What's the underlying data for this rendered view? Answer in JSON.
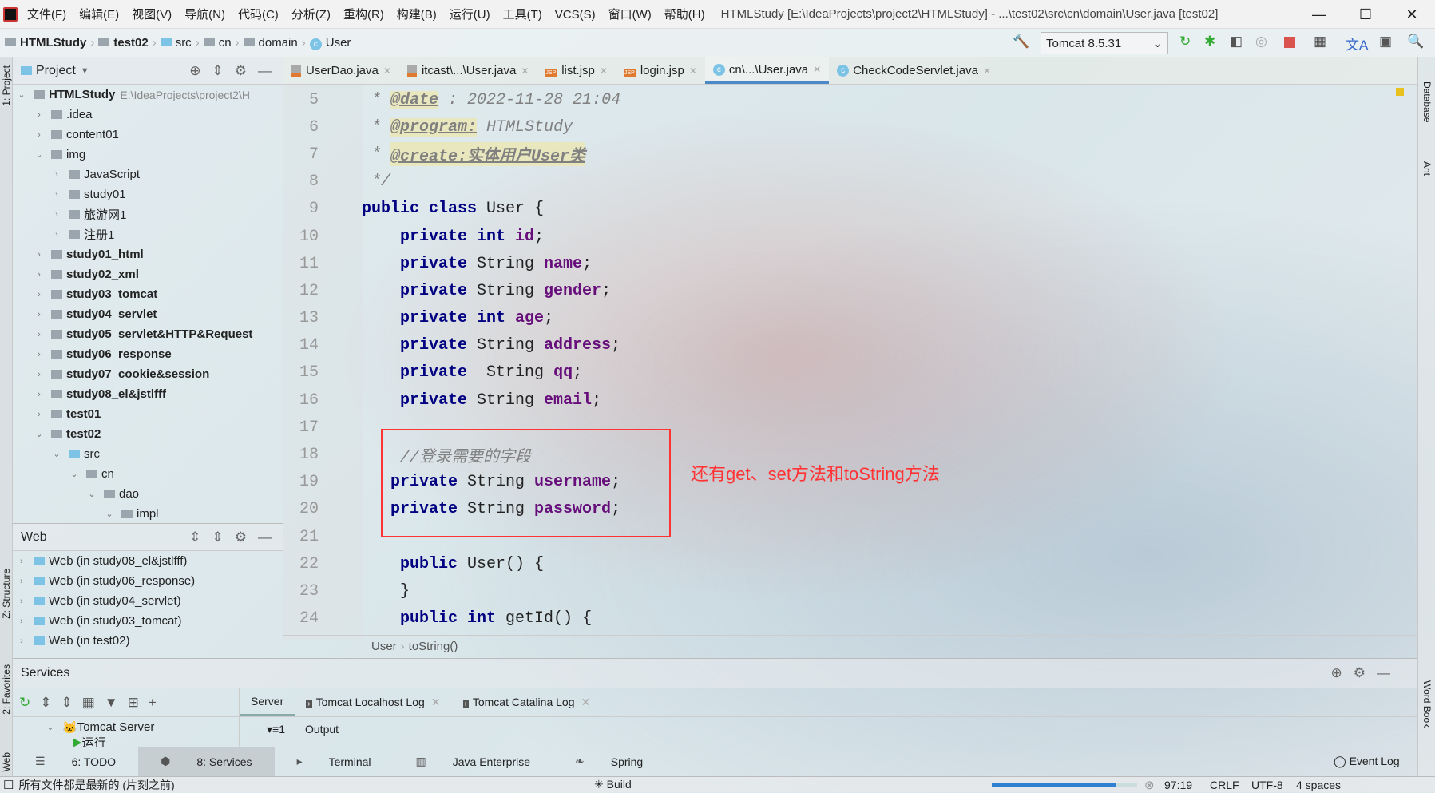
{
  "titlebar": {
    "menu": [
      "文件(F)",
      "编辑(E)",
      "视图(V)",
      "导航(N)",
      "代码(C)",
      "分析(Z)",
      "重构(R)",
      "构建(B)",
      "运行(U)",
      "工具(T)",
      "VCS(S)",
      "窗口(W)",
      "帮助(H)"
    ],
    "title": "HTMLStudy [E:\\IdeaProjects\\project2\\HTMLStudy] - ...\\test02\\src\\cn\\domain\\User.java [test02]"
  },
  "breadcrumb": [
    "HTMLStudy",
    "test02",
    "src",
    "cn",
    "domain",
    "User"
  ],
  "run_config": "Tomcat 8.5.31",
  "project_panel": {
    "title": "Project",
    "root": "HTMLStudy",
    "root_path": "E:\\IdeaProjects\\project2\\H",
    "items": [
      {
        "label": ".idea",
        "depth": 1,
        "state": "closed",
        "bold": false
      },
      {
        "label": "content01",
        "depth": 1,
        "state": "closed",
        "bold": false
      },
      {
        "label": "img",
        "depth": 1,
        "state": "open",
        "bold": false
      },
      {
        "label": "JavaScript",
        "depth": 2,
        "state": "closed",
        "bold": false
      },
      {
        "label": "study01",
        "depth": 2,
        "state": "closed",
        "bold": false
      },
      {
        "label": "旅游网1",
        "depth": 2,
        "state": "closed",
        "bold": false
      },
      {
        "label": "注册1",
        "depth": 2,
        "state": "closed",
        "bold": false
      },
      {
        "label": "study01_html",
        "depth": 1,
        "state": "closed",
        "bold": true
      },
      {
        "label": "study02_xml",
        "depth": 1,
        "state": "closed",
        "bold": true
      },
      {
        "label": "study03_tomcat",
        "depth": 1,
        "state": "closed",
        "bold": true
      },
      {
        "label": "study04_servlet",
        "depth": 1,
        "state": "closed",
        "bold": true
      },
      {
        "label": "study05_servlet&HTTP&Request",
        "depth": 1,
        "state": "closed",
        "bold": true
      },
      {
        "label": "study06_response",
        "depth": 1,
        "state": "closed",
        "bold": true
      },
      {
        "label": "study07_cookie&session",
        "depth": 1,
        "state": "closed",
        "bold": true
      },
      {
        "label": "study08_el&jstlfff",
        "depth": 1,
        "state": "closed",
        "bold": true
      },
      {
        "label": "test01",
        "depth": 1,
        "state": "closed",
        "bold": true
      },
      {
        "label": "test02",
        "depth": 1,
        "state": "open",
        "bold": true
      },
      {
        "label": "src",
        "depth": 2,
        "state": "open",
        "bold": false
      },
      {
        "label": "cn",
        "depth": 3,
        "state": "open",
        "bold": false
      },
      {
        "label": "dao",
        "depth": 4,
        "state": "open",
        "bold": false
      },
      {
        "label": "impl",
        "depth": 5,
        "state": "open",
        "bold": false
      }
    ]
  },
  "web_panel": {
    "title": "Web",
    "items": [
      "Web (in study08_el&jstlfff)",
      "Web (in study06_response)",
      "Web (in study04_servlet)",
      "Web (in study03_tomcat)",
      "Web (in test02)"
    ]
  },
  "tabs": [
    {
      "label": "UserDao.java",
      "type": "java"
    },
    {
      "label": "itcast\\...\\User.java",
      "type": "java"
    },
    {
      "label": "list.jsp",
      "type": "jsp"
    },
    {
      "label": "login.jsp",
      "type": "jsp"
    },
    {
      "label": "cn\\...\\User.java",
      "type": "class",
      "active": true
    },
    {
      "label": "CheckCodeServlet.java",
      "type": "class"
    }
  ],
  "code": [
    {
      "n": "5",
      "parts": [
        [
          "cm",
          " * "
        ],
        [
          "tag",
          "@date"
        ],
        [
          "cm",
          " : 2022-11-28 21:04"
        ]
      ]
    },
    {
      "n": "6",
      "parts": [
        [
          "cm",
          " * "
        ],
        [
          "tag",
          "@program:"
        ],
        [
          "cm",
          " HTMLStudy"
        ]
      ]
    },
    {
      "n": "7",
      "parts": [
        [
          "cm",
          " * "
        ],
        [
          "tag",
          "@create:实体用户User类"
        ]
      ]
    },
    {
      "n": "8",
      "parts": [
        [
          "cm",
          " */"
        ]
      ]
    },
    {
      "n": "9",
      "parts": [
        [
          "kw",
          "public class "
        ],
        [
          "",
          "User {"
        ]
      ]
    },
    {
      "n": "10",
      "parts": [
        [
          "",
          "    "
        ],
        [
          "kw",
          "private int "
        ],
        [
          "fld",
          "id"
        ],
        [
          "",
          ";"
        ]
      ]
    },
    {
      "n": "11",
      "parts": [
        [
          "",
          "    "
        ],
        [
          "kw",
          "private "
        ],
        [
          "",
          "String "
        ],
        [
          "fld",
          "name"
        ],
        [
          "",
          ";"
        ]
      ]
    },
    {
      "n": "12",
      "parts": [
        [
          "",
          "    "
        ],
        [
          "kw",
          "private "
        ],
        [
          "",
          "String "
        ],
        [
          "fld",
          "gender"
        ],
        [
          "",
          ";"
        ]
      ]
    },
    {
      "n": "13",
      "parts": [
        [
          "",
          "    "
        ],
        [
          "kw",
          "private int "
        ],
        [
          "fld",
          "age"
        ],
        [
          "",
          ";"
        ]
      ]
    },
    {
      "n": "14",
      "parts": [
        [
          "",
          "    "
        ],
        [
          "kw",
          "private "
        ],
        [
          "",
          "String "
        ],
        [
          "fld",
          "address"
        ],
        [
          "",
          ";"
        ]
      ]
    },
    {
      "n": "15",
      "parts": [
        [
          "",
          "    "
        ],
        [
          "kw",
          "private  "
        ],
        [
          "",
          "String "
        ],
        [
          "fld",
          "qq"
        ],
        [
          "",
          ";"
        ]
      ]
    },
    {
      "n": "16",
      "parts": [
        [
          "",
          "    "
        ],
        [
          "kw",
          "private "
        ],
        [
          "",
          "String "
        ],
        [
          "fld",
          "email"
        ],
        [
          "",
          ";"
        ]
      ]
    },
    {
      "n": "17",
      "parts": []
    },
    {
      "n": "18",
      "parts": [
        [
          "cm",
          "    //登录需要的字段"
        ]
      ]
    },
    {
      "n": "19",
      "parts": [
        [
          "",
          "   "
        ],
        [
          "kw",
          "private "
        ],
        [
          "",
          "String "
        ],
        [
          "fld",
          "username"
        ],
        [
          "",
          ";"
        ]
      ]
    },
    {
      "n": "20",
      "parts": [
        [
          "",
          "   "
        ],
        [
          "kw",
          "private "
        ],
        [
          "",
          "String "
        ],
        [
          "fld",
          "password"
        ],
        [
          "",
          ";"
        ]
      ]
    },
    {
      "n": "21",
      "parts": []
    },
    {
      "n": "22",
      "parts": [
        [
          "",
          "    "
        ],
        [
          "kw",
          "public "
        ],
        [
          "",
          "User() {"
        ]
      ]
    },
    {
      "n": "23",
      "parts": [
        [
          "",
          "    }"
        ]
      ]
    },
    {
      "n": "24",
      "parts": [
        [
          "",
          "    "
        ],
        [
          "kw",
          "public int "
        ],
        [
          "",
          "getId() {"
        ]
      ]
    }
  ],
  "annotation": "还有get、set方法和toString方法",
  "editor_breadcrumb": [
    "User",
    "toString()"
  ],
  "services": {
    "title": "Services",
    "server_node": "Tomcat Server",
    "run_node": "运行",
    "tabs": [
      "Server",
      "Tomcat Localhost Log",
      "Tomcat Catalina Log"
    ],
    "output_label": "Output",
    "output_count": "1"
  },
  "side_left": [
    "1: Project",
    "Z: Structure",
    "2: Favorites",
    "Web"
  ],
  "side_right": [
    "Database",
    "Ant",
    "Word Book"
  ],
  "bottom_tabs": [
    "6: TODO",
    "8: Services",
    "Terminal",
    "Java Enterprise",
    "Spring"
  ],
  "event_log": "Event Log",
  "status": {
    "message": "所有文件都是最新的 (片刻之前)",
    "build": "Build",
    "position": "97:19",
    "line_sep": "CRLF",
    "encoding": "UTF-8",
    "indent": "4 spaces",
    "progress": 0.85
  }
}
